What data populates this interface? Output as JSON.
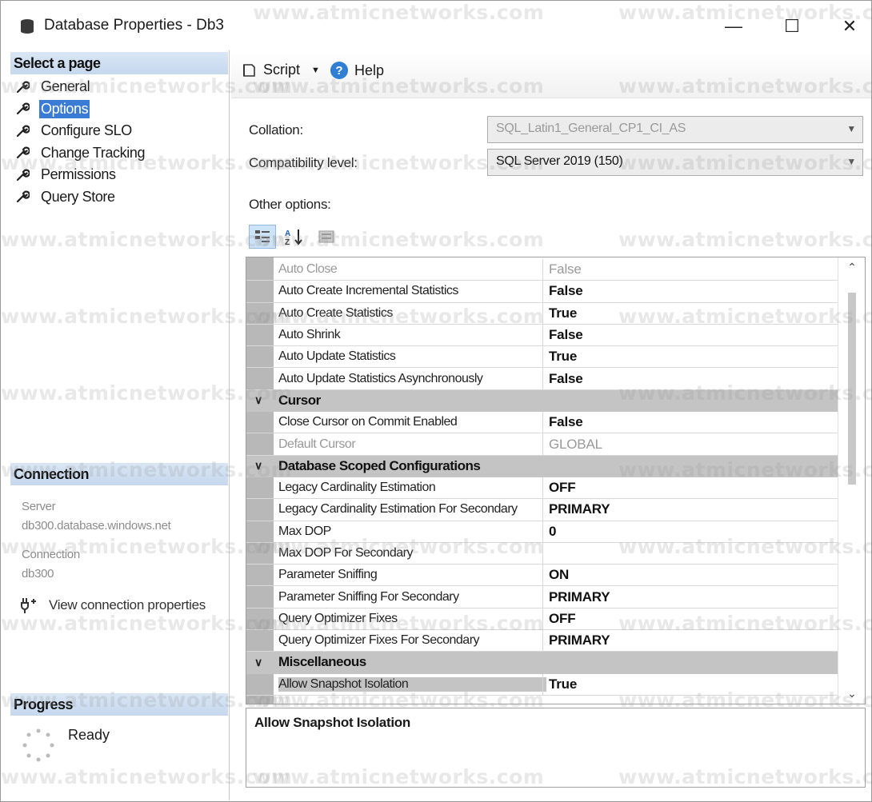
{
  "window": {
    "title": "Database Properties - Db3",
    "controls": {
      "minimize": "—",
      "maximize": "☐",
      "close": "✕"
    }
  },
  "left": {
    "select_page_header": "Select a page",
    "pages": [
      {
        "label": "General",
        "selected": false
      },
      {
        "label": "Options",
        "selected": true
      },
      {
        "label": "Configure SLO",
        "selected": false
      },
      {
        "label": "Change Tracking",
        "selected": false
      },
      {
        "label": "Permissions",
        "selected": false
      },
      {
        "label": "Query Store",
        "selected": false
      }
    ],
    "connection_header": "Connection",
    "server_label": "Server",
    "server_value": "db300.database.windows.net",
    "connection_label": "Connection",
    "connection_value": "db300",
    "view_connection_link": "View connection properties",
    "progress_header": "Progress",
    "progress_status": "Ready"
  },
  "toolbar": {
    "script_label": "Script",
    "help_label": "Help"
  },
  "form": {
    "collation_label": "Collation:",
    "collation_value": "SQL_Latin1_General_CP1_CI_AS",
    "compat_label": "Compatibility level:",
    "compat_value": "SQL Server 2019 (150)",
    "other_options_label": "Other options:"
  },
  "grid": {
    "rows": [
      {
        "kind": "prop",
        "name": "Auto Close",
        "value": "False",
        "dim": true
      },
      {
        "kind": "prop",
        "name": "Auto Create Incremental Statistics",
        "value": "False"
      },
      {
        "kind": "prop",
        "name": "Auto Create Statistics",
        "value": "True"
      },
      {
        "kind": "prop",
        "name": "Auto Shrink",
        "value": "False"
      },
      {
        "kind": "prop",
        "name": "Auto Update Statistics",
        "value": "True"
      },
      {
        "kind": "prop",
        "name": "Auto Update Statistics Asynchronously",
        "value": "False"
      },
      {
        "kind": "cat",
        "name": "Cursor"
      },
      {
        "kind": "prop",
        "name": "Close Cursor on Commit Enabled",
        "value": "False"
      },
      {
        "kind": "prop",
        "name": "Default Cursor",
        "value": "GLOBAL",
        "dim": true
      },
      {
        "kind": "cat",
        "name": "Database Scoped Configurations"
      },
      {
        "kind": "prop",
        "name": "Legacy Cardinality Estimation",
        "value": "OFF"
      },
      {
        "kind": "prop",
        "name": "Legacy Cardinality Estimation For Secondary",
        "value": "PRIMARY"
      },
      {
        "kind": "prop",
        "name": "Max DOP",
        "value": "0"
      },
      {
        "kind": "prop",
        "name": "Max DOP For Secondary",
        "value": ""
      },
      {
        "kind": "prop",
        "name": "Parameter Sniffing",
        "value": "ON"
      },
      {
        "kind": "prop",
        "name": "Parameter Sniffing For Secondary",
        "value": "PRIMARY"
      },
      {
        "kind": "prop",
        "name": "Query Optimizer Fixes",
        "value": "OFF"
      },
      {
        "kind": "prop",
        "name": "Query Optimizer Fixes For Secondary",
        "value": "PRIMARY"
      },
      {
        "kind": "cat",
        "name": "Miscellaneous"
      },
      {
        "kind": "prop",
        "name": "Allow Snapshot Isolation",
        "value": "True",
        "selected": true
      }
    ]
  },
  "description": {
    "title": "Allow Snapshot Isolation"
  },
  "watermark_text": "www.atmicnetworks.com"
}
